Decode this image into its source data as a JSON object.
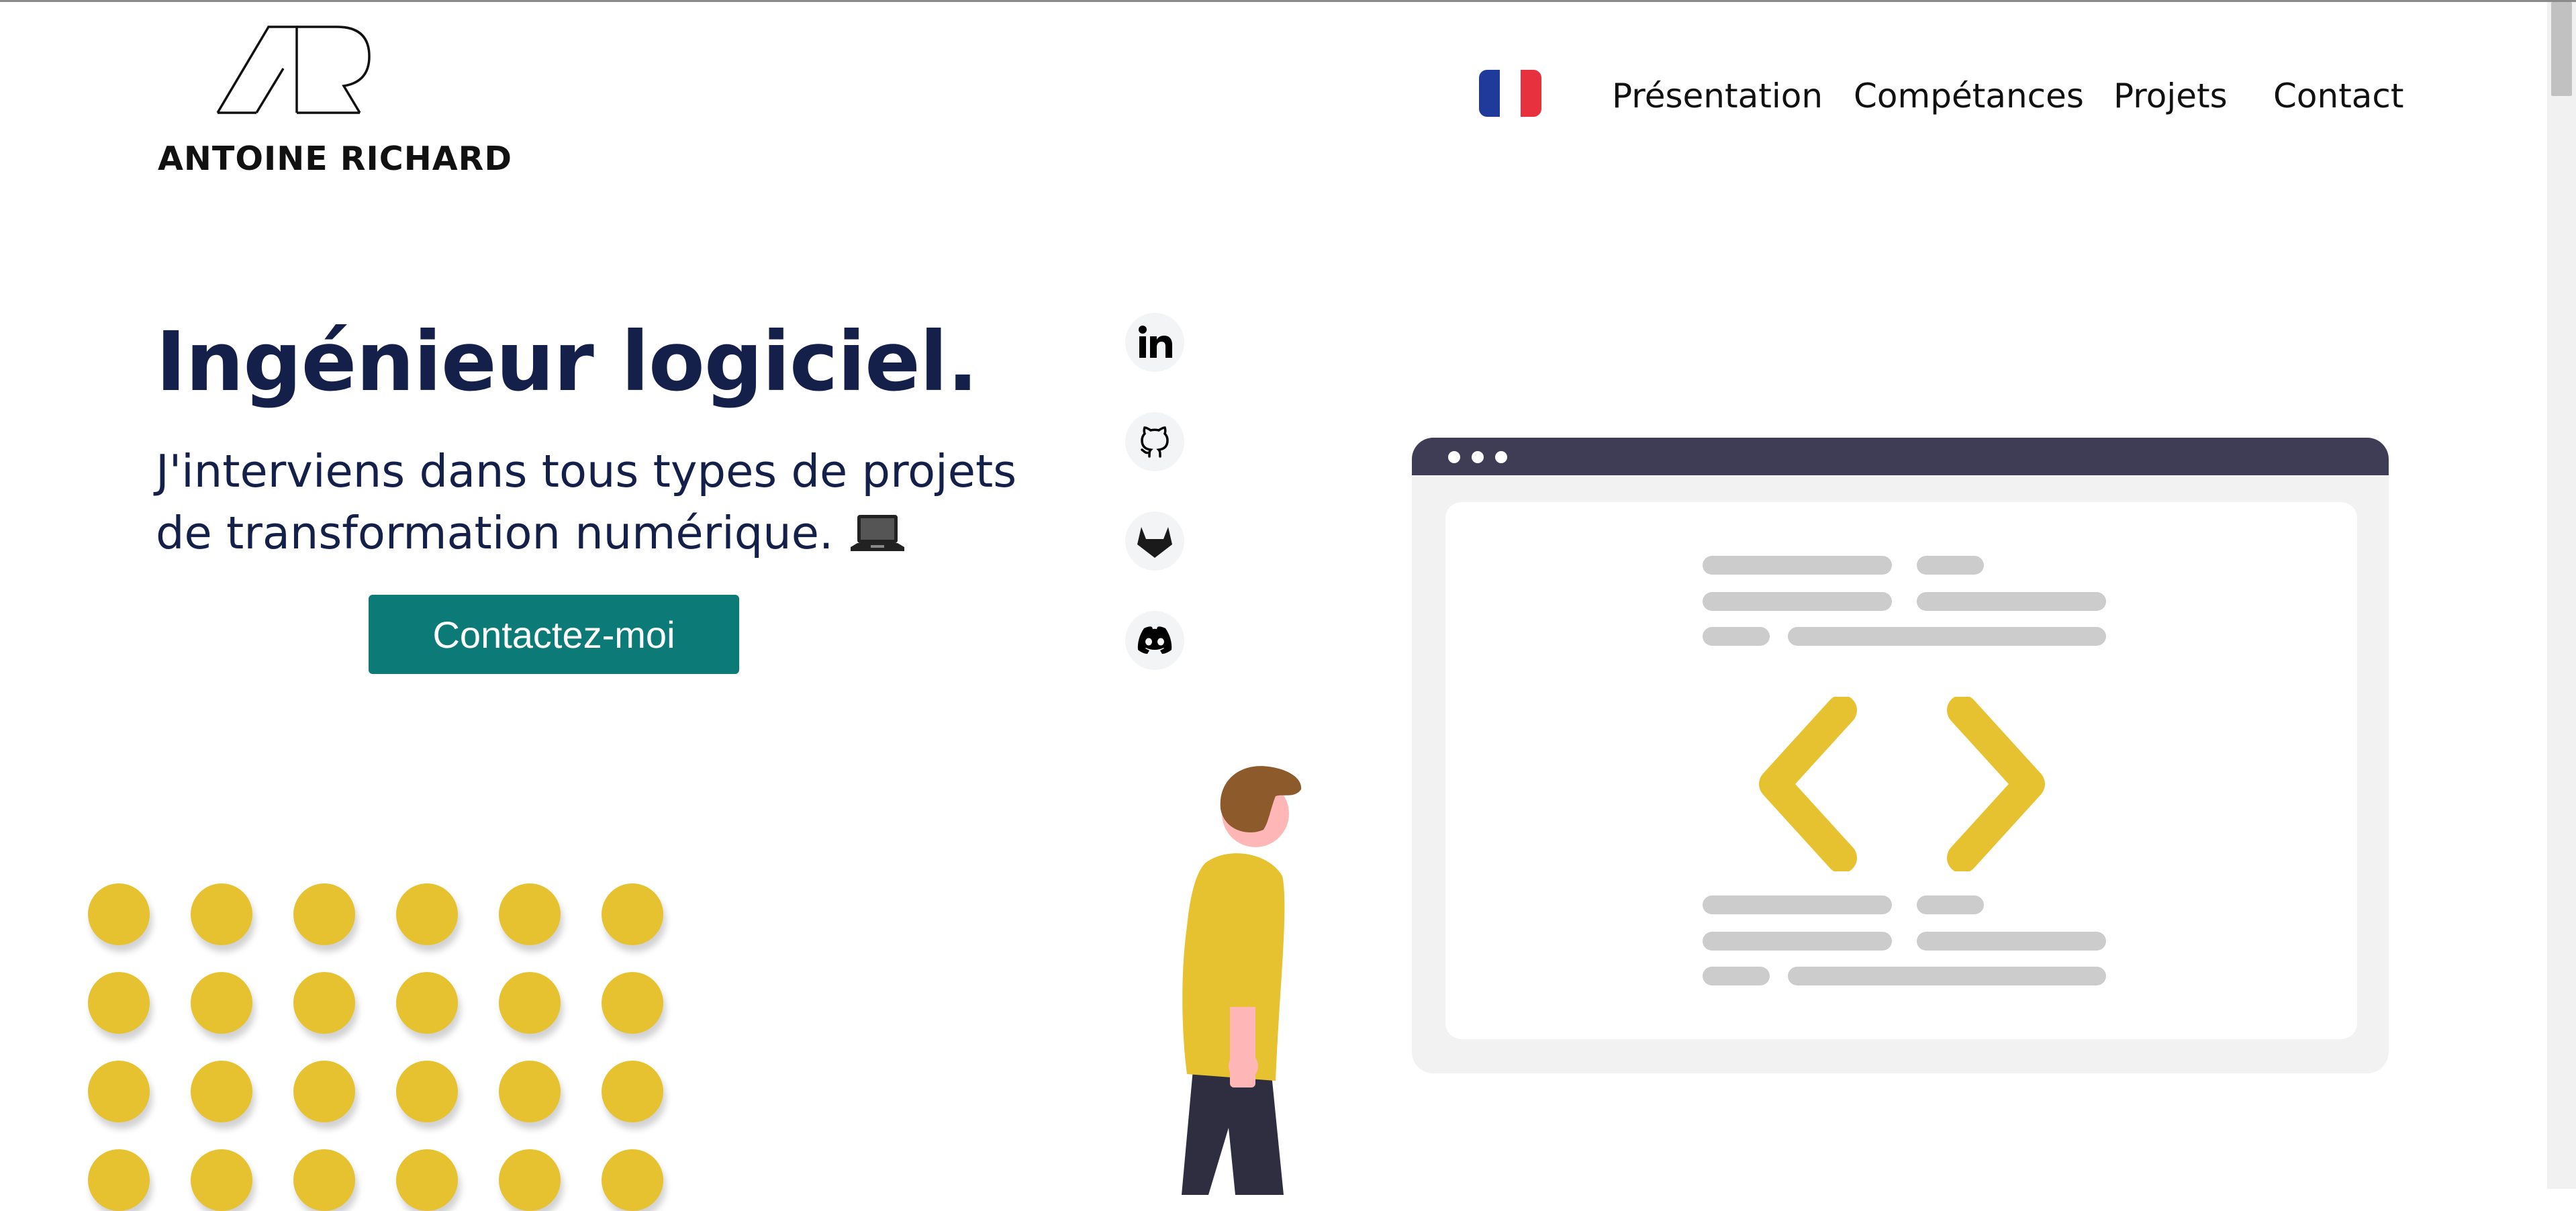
{
  "brand": {
    "name": "ANTOINE RICHARD",
    "monogram": "AR"
  },
  "nav": {
    "language": {
      "icon": "french-flag-icon",
      "colors": [
        "#1f3a9a",
        "#ffffff",
        "#e8313f"
      ]
    },
    "links": [
      "Présentation",
      "Compétances",
      "Projets",
      "Contact"
    ]
  },
  "hero": {
    "title": "Ingénieur logiciel.",
    "subtitle": "J'interviens dans tous types de projets de transformation numérique.",
    "subtitle_icon": "laptop-icon",
    "cta_label": "Contactez-moi"
  },
  "social": [
    {
      "name": "linkedin",
      "icon": "linkedin-icon"
    },
    {
      "name": "github",
      "icon": "github-icon"
    },
    {
      "name": "gitlab",
      "icon": "gitlab-icon"
    },
    {
      "name": "discord",
      "icon": "discord-icon"
    }
  ],
  "illustration": {
    "icon": "code-brackets-icon",
    "figure": "person-illustration",
    "decoration": "dot-grid"
  },
  "colors": {
    "title": "#14204a",
    "accent_button": "#0c7b78",
    "yellow": "#e6c231",
    "browser_bar": "#3f3d56"
  }
}
